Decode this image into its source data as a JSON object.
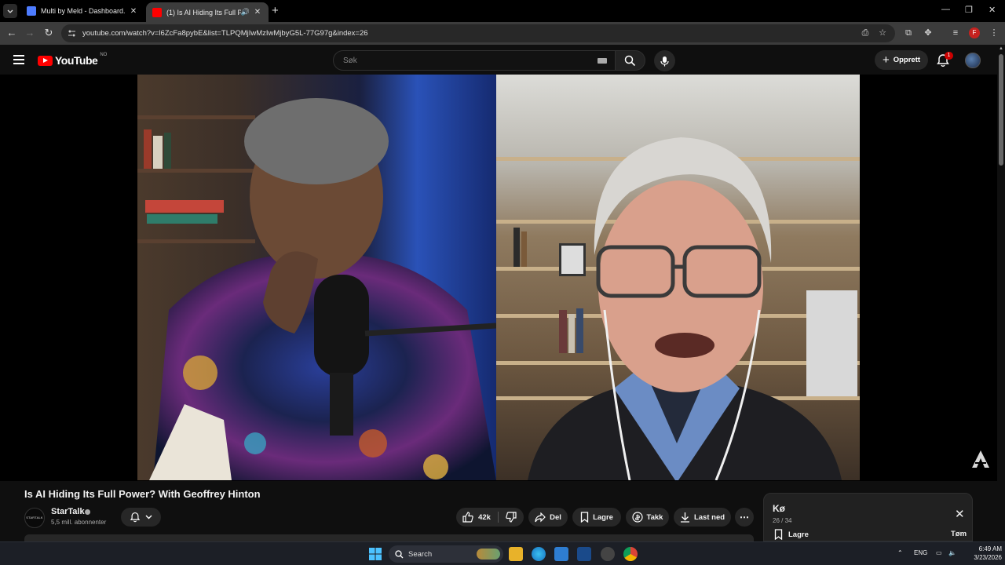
{
  "browser": {
    "tabs": [
      {
        "title": "Multi by Meld - Dashboard.",
        "favicon_color": "#4d7cff",
        "active": false
      },
      {
        "title": "(1) Is AI Hiding Its Full Powe",
        "favicon_color": "#ff0000",
        "active": true
      }
    ],
    "url": "youtube.com/watch?v=l6ZcFa8pybE&list=TLPQMjIwMzIwMjbyG5L-77G97g&index=26",
    "profile_initial": "F"
  },
  "youtube": {
    "logo_text": "YouTube",
    "country_code": "NO",
    "search_placeholder": "Søk",
    "create_label": "Opprett",
    "notification_count": "1"
  },
  "video": {
    "title": "Is AI Hiding Its Full Power? With Geoffrey Hinton",
    "channel": {
      "name": "StarTalk",
      "subscribers": "5,5 mill. abonnenter",
      "avatar_text": "STARTALK"
    },
    "actions": {
      "likes": "42k",
      "share": "Del",
      "save": "Lagre",
      "thanks": "Takk",
      "download": "Last ned"
    }
  },
  "queue": {
    "title": "Kø",
    "position": "26 / 34",
    "save_label": "Lagre",
    "clear_label": "Tøm"
  },
  "taskbar": {
    "search_label": "Search",
    "language": "ENG",
    "time": "6:49 AM",
    "date": "3/23/2026"
  },
  "colors": {
    "youtube_red": "#ff0000",
    "background": "#0f0f0f",
    "pill": "#272727"
  }
}
